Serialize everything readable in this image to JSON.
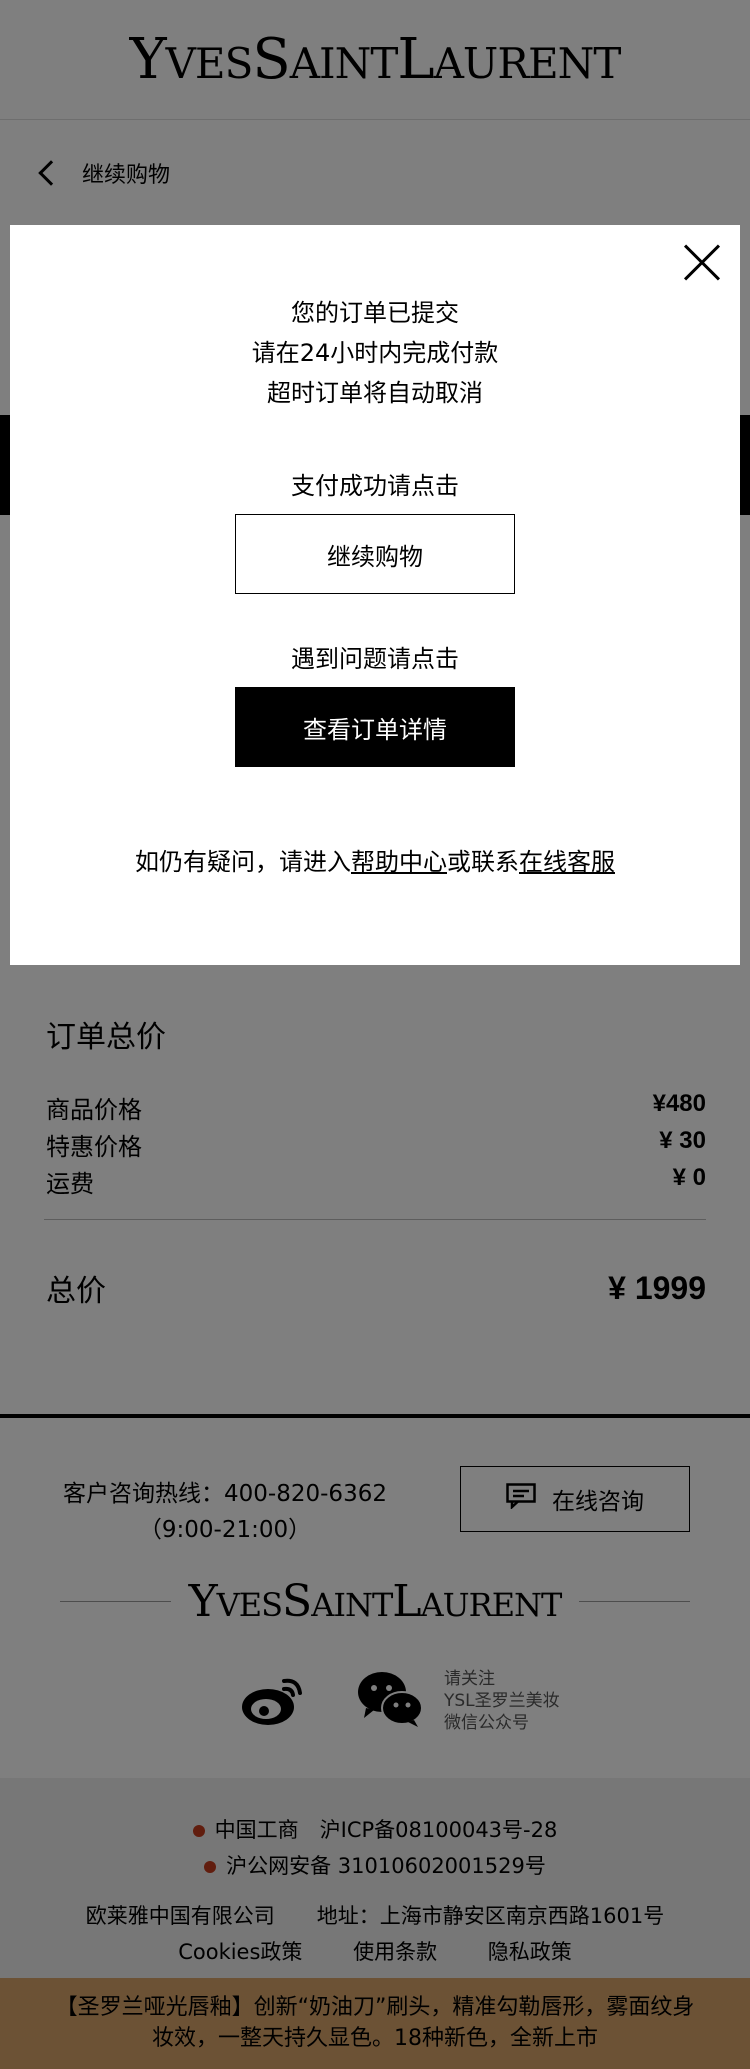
{
  "brand": {
    "logo_text": "YvesSaintLaurent"
  },
  "nav": {
    "continue_label": "继续购物"
  },
  "totals": {
    "title": "订单总价",
    "rows": [
      {
        "label": "商品价格",
        "value": "¥480"
      },
      {
        "label": "特惠价格",
        "value": "¥ 30"
      },
      {
        "label": "运费",
        "value": "¥ 0"
      }
    ],
    "grand_label": "总价",
    "grand_value": "¥ 1999"
  },
  "footer": {
    "hotline_line1": "客户咨询热线：400-820-6362",
    "hotline_line2": "（9:00-21:00）",
    "consult_label": "在线咨询",
    "logo_text": "YvesSaintLaurent",
    "wechat_text": [
      "请关注",
      "YSL圣罗兰美妆",
      "微信公众号"
    ]
  },
  "legal": {
    "icp": "中国工商　沪ICP备08100043号-28",
    "police": "沪公网安备 31010602001529号",
    "company": "欧莱雅中国有限公司　　地址：上海市静安区南京西路1601号",
    "links": [
      "Cookies政策",
      "使用条款",
      "隐私政策"
    ]
  },
  "promo": {
    "text": "【圣罗兰哑光唇釉】创新“奶油刀”刷头，精准勾勒唇形，雾面纹身妆效，一整天持久显色。18种新色，全新上市"
  },
  "modal": {
    "line1": "您的订单已提交",
    "line2": "请在24小时内完成付款",
    "line3": "超时订单将自动取消",
    "pay_success_prompt": "支付成功请点击",
    "continue_button": "继续购物",
    "problem_prompt": "遇到问题请点击",
    "order_detail_button": "查看订单详情",
    "help_prefix": "如仍有疑问，请进入",
    "help_center_link": "帮助中心",
    "help_middle": "或联系",
    "online_service_link": "在线客服"
  }
}
